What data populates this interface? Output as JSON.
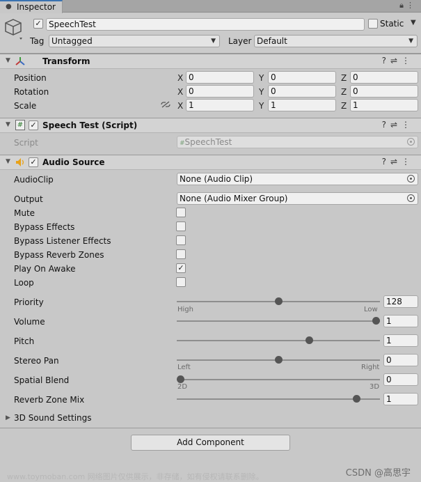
{
  "tab": {
    "label": "Inspector",
    "icon": "info-icon"
  },
  "tab_tools": {
    "lock": "lock-icon",
    "menu": "kebab-menu-icon"
  },
  "object": {
    "active": true,
    "name": "SpeechTest",
    "static_label": "Static",
    "tag_label": "Tag",
    "tag_value": "Untagged",
    "layer_label": "Layer",
    "layer_value": "Default"
  },
  "transform": {
    "title": "Transform",
    "position_label": "Position",
    "rotation_label": "Rotation",
    "scale_label": "Scale",
    "axis": {
      "x": "X",
      "y": "Y",
      "z": "Z"
    },
    "position": {
      "x": "0",
      "y": "0",
      "z": "0"
    },
    "rotation": {
      "x": "0",
      "y": "0",
      "z": "0"
    },
    "scale": {
      "x": "1",
      "y": "1",
      "z": "1"
    }
  },
  "speech_test": {
    "title": "Speech Test (Script)",
    "enabled": true,
    "script_label": "Script",
    "script_value": "SpeechTest"
  },
  "audio_source": {
    "title": "Audio Source",
    "enabled": true,
    "audioclip_label": "AudioClip",
    "audioclip_value": "None (Audio Clip)",
    "output_label": "Output",
    "output_value": "None (Audio Mixer Group)",
    "mute_label": "Mute",
    "bypass_effects_label": "Bypass Effects",
    "bypass_listener_label": "Bypass Listener Effects",
    "bypass_reverb_label": "Bypass Reverb Zones",
    "play_on_awake_label": "Play On Awake",
    "play_on_awake_mark": "✓",
    "loop_label": "Loop",
    "priority_label": "Priority",
    "priority_value": "128",
    "priority_fraction": 0.5,
    "priority_high": "High",
    "priority_low": "Low",
    "volume_label": "Volume",
    "volume_value": "1",
    "volume_fraction": 1.0,
    "pitch_label": "Pitch",
    "pitch_value": "1",
    "pitch_fraction": 0.66,
    "stereo_pan_label": "Stereo Pan",
    "stereo_pan_value": "0",
    "stereo_pan_fraction": 0.5,
    "stereo_pan_left": "Left",
    "stereo_pan_right": "Right",
    "spatial_blend_label": "Spatial Blend",
    "spatial_blend_value": "0",
    "spatial_blend_fraction": 0.0,
    "spatial_2d": "2D",
    "spatial_3d": "3D",
    "reverb_mix_label": "Reverb Zone Mix",
    "reverb_mix_value": "1",
    "reverb_mix_fraction": 0.9,
    "sound_settings_label": "3D Sound Settings"
  },
  "add_component_label": "Add Component",
  "watermark": {
    "left": "www.toymoban.com 网络图片仅供展示，非存储，如有侵权请联系删除。",
    "right": "CSDN @高思宇"
  },
  "colors": {
    "accent": "#3a72b0",
    "audio_icon": "#e8a21a",
    "panel": "#c8c8c8"
  }
}
